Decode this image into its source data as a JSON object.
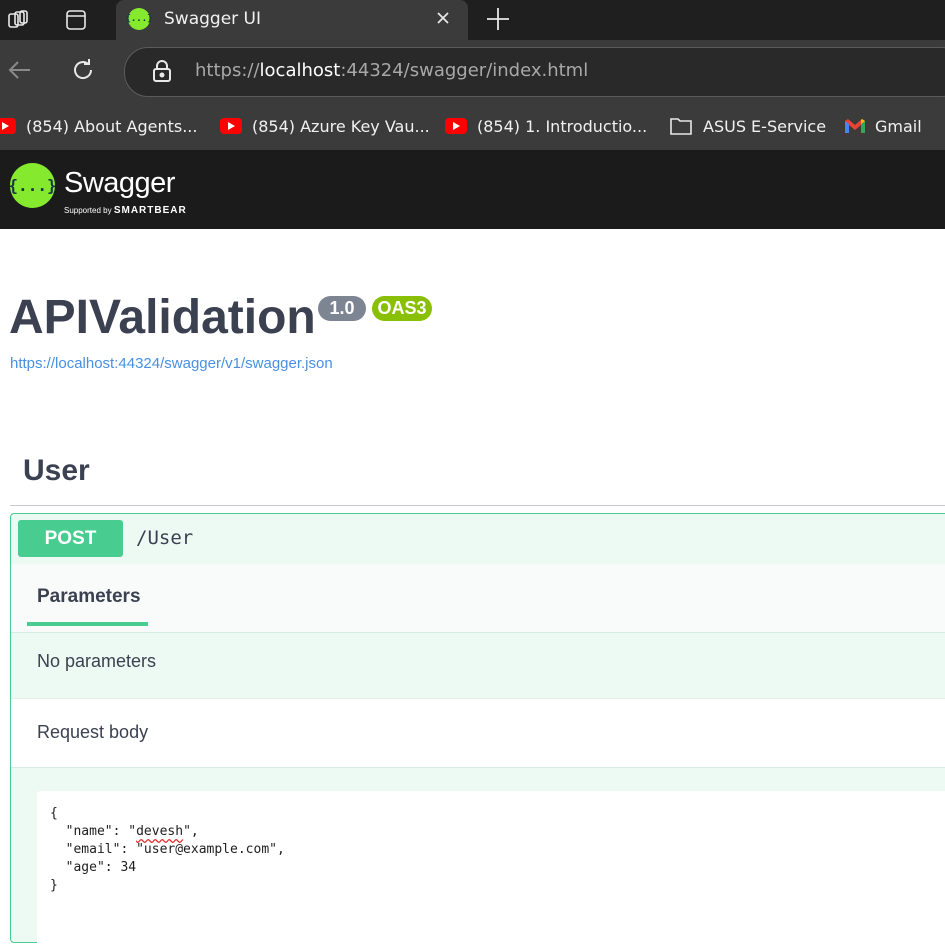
{
  "browser": {
    "tab": {
      "title": "Swagger UI",
      "favicon_text": "{...}"
    },
    "url": {
      "scheme": "https://",
      "host": "localhost",
      "rest": ":44324/swagger/index.html"
    },
    "bookmarks": [
      {
        "label": "(854) About Agents...",
        "icon": "youtube-icon"
      },
      {
        "label": "(854) Azure Key Vau...",
        "icon": "youtube-icon"
      },
      {
        "label": "(854) 1. Introductio...",
        "icon": "youtube-icon"
      },
      {
        "label": "ASUS E-Service",
        "icon": "folder-icon"
      },
      {
        "label": "Gmail",
        "icon": "gmail-icon"
      }
    ]
  },
  "swagger_header": {
    "logo_text": "{...}",
    "name": "Swagger",
    "supported_by": "Supported by",
    "brand": "SMARTBEAR"
  },
  "info": {
    "title": "APIValidation",
    "version": "1.0",
    "oas": "OAS3",
    "spec_url": "https://localhost:44324/swagger/v1/swagger.json"
  },
  "tag": {
    "name": "User"
  },
  "operation": {
    "method": "POST",
    "path": "/User",
    "parameters_tab": "Parameters",
    "no_parameters": "No parameters",
    "request_body_label": "Request body",
    "body": {
      "open": "{",
      "name_key": "  \"name\": \"",
      "name_value": "devesh",
      "name_end": "\",",
      "email_line": "  \"email\": \"user@example.com\",",
      "age_line": "  \"age\": 34",
      "close": "}"
    }
  },
  "colors": {
    "post_green": "#49cc90",
    "swagger_green": "#85ea2d",
    "version_gray": "#7d8492",
    "oas_green": "#89bf04",
    "link_blue": "#4990e2",
    "text_dark": "#3b4151"
  }
}
